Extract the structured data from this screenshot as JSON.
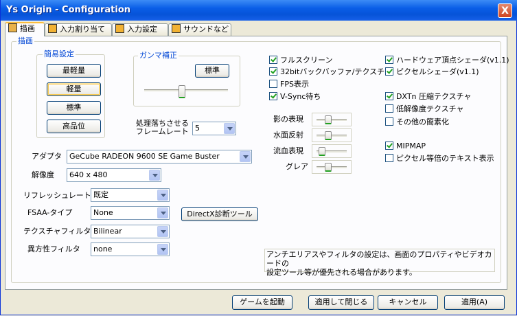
{
  "window": {
    "title": "Ys Origin - Configuration",
    "close_glyph": "X"
  },
  "tabs": [
    {
      "label": "描画",
      "icon": "monitor-icon",
      "active": true
    },
    {
      "label": "入力割り当て",
      "icon": "controller-icon",
      "active": false
    },
    {
      "label": "入力設定",
      "icon": "controller-icon",
      "active": false
    },
    {
      "label": "サウンドなど",
      "icon": "sound-icon",
      "active": false
    }
  ],
  "panel": {
    "group_label": "描画",
    "preset": {
      "label": "簡易設定",
      "buttons": [
        "最軽量",
        "軽量",
        "標準",
        "高品位"
      ],
      "focused": "軽量"
    },
    "gamma": {
      "label": "ガンマ補正",
      "reset_button": "標準",
      "value_percent": 45
    },
    "frame_skip": {
      "label_line1": "処理落ちさせる",
      "label_line2": "フレームレート",
      "value": "5"
    },
    "adapter": {
      "label": "アダプタ",
      "value": "GeCube RADEON 9600 SE Game Buster"
    },
    "resolution": {
      "label": "解像度",
      "value": "640 x 480"
    },
    "refresh_rate": {
      "label": "リフレッシュレート",
      "value": "既定"
    },
    "fsaa": {
      "label": "FSAA-タイプ",
      "value": "None"
    },
    "texture_filter": {
      "label": "テクスチャフィルタ",
      "value": "Bilinear"
    },
    "anisotropic": {
      "label": "異方性フィルタ",
      "value": "none"
    },
    "dxdiag_button": "DirectX診断ツール",
    "checks_left": [
      {
        "label": "フルスクリーン",
        "checked": true
      },
      {
        "label": "32bitバックバッファ/テクスチャ",
        "checked": true
      },
      {
        "label": "FPS表示",
        "checked": false
      },
      {
        "label": "V-Sync待ち",
        "checked": true
      }
    ],
    "effects": [
      {
        "label": "影の表現",
        "value_percent": 35
      },
      {
        "label": "水面反射",
        "value_percent": 35
      },
      {
        "label": "流血表現",
        "value_percent": 10
      },
      {
        "label": "グレア",
        "value_percent": 35
      }
    ],
    "checks_right": [
      {
        "label": "ハードウェア頂点シェーダ(v1.1)",
        "checked": true
      },
      {
        "label": "ピクセルシェーダ(v1.1)",
        "checked": true
      },
      {
        "label": "DXTn 圧縮テクスチャ",
        "checked": true
      },
      {
        "label": "低解像度テクスチャ",
        "checked": false
      },
      {
        "label": "その他の簡素化",
        "checked": false
      },
      {
        "label": "MIPMAP",
        "checked": true
      },
      {
        "label": "ピクセル等倍のテキスト表示",
        "checked": false
      }
    ],
    "note_line1": "アンチエリアスやフィルタの設定は、画面のプロパティやビデオカードの",
    "note_line2": "設定ツール等が優先される場合があります。"
  },
  "footer": {
    "launch": "ゲームを起動",
    "apply_close": "適用して閉じる",
    "cancel": "キャンセル",
    "apply": "適用(A)"
  }
}
